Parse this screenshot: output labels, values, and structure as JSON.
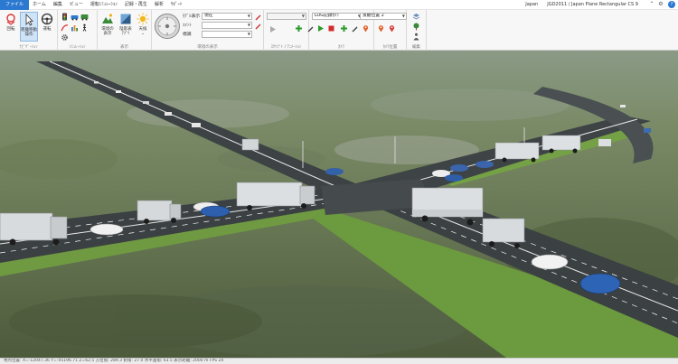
{
  "menubar": {
    "tabs": [
      "ファイル",
      "ホーム",
      "編集",
      "ビュー",
      "運転ｼﾐｭﾚｰｼｮﾝ",
      "記録・再生",
      "解析",
      "ｻﾎﾟｰﾄ"
    ],
    "active_tab": 0,
    "region": "Japan",
    "crs": "JGD2011 / Japan Plane Rectangular CS 9"
  },
  "ribbon": {
    "navigation": {
      "label": "ﾅﾋﾞｹﾞｰｼｮﾝ",
      "rotate_label": "回転",
      "walk_label": "距離移動",
      "walk_label2": "操作",
      "drive_label": "運転"
    },
    "simulation": {
      "label": "ｼﾐｭﾚｰｼｮﾝ"
    },
    "view": {
      "label": "表示",
      "env_label": "環境の",
      "env_label2": "表示",
      "sun_label": "天候",
      "lighting_label": "陰影表",
      "lighting_label2": "ｱﾌﾟﾘ"
    },
    "display": {
      "label": "環境の表示",
      "model_label": "ﾓﾃﾞﾙ表示",
      "model_value": "現在",
      "comment_label": "ｺﾒﾝﾄ",
      "comment_value": "",
      "sign_label": "標識",
      "sign_value": ""
    },
    "script": {
      "label": "ｽｸﾘﾌﾟﾄ / ｱﾆﾒｰｼｮﾝ",
      "combo_value": ""
    },
    "camera": {
      "label": "ｶﾒﾗ",
      "camera_value": "LOG記録ｶﾒﾗ"
    },
    "camera_position": {
      "label": "ｶﾒﾗ位置",
      "value": "景観位置 2"
    },
    "edit": {
      "label": "編集"
    }
  },
  "statusbar": {
    "text": "視点位置: X=-12047.36  Y=-45196.71  Z=62.5   方位角: 289.3   俯角: 27.0   水平画角: 63.5   表示距離: 2000 m   FPS 24"
  },
  "colors": {
    "accent": "#2b79d0",
    "road": "#3d4244",
    "grass": "#6f9a42",
    "terrain": "#6c7a5c"
  }
}
